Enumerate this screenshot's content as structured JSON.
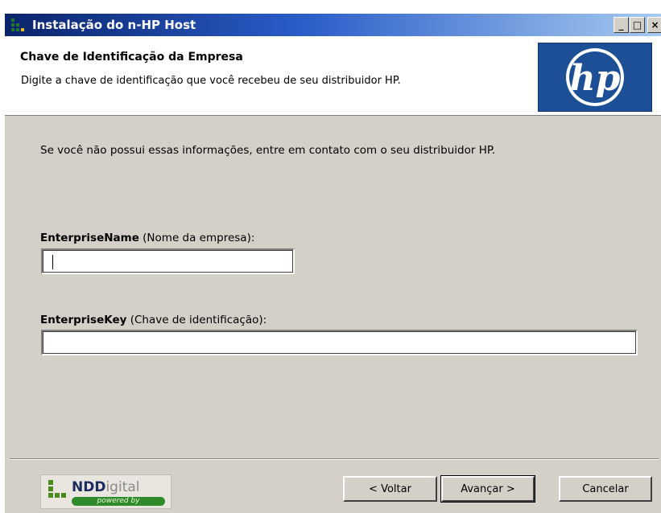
{
  "window": {
    "title": "Instalação do n-HP Host",
    "controls": {
      "minimize_icon": "minimize-icon",
      "maximize_icon": "maximize-icon",
      "close_icon": "close-icon",
      "minimize_glyph": "_",
      "maximize_glyph": "□",
      "close_glyph": "×"
    }
  },
  "header": {
    "title": "Chave de Identificação da Empresa",
    "description": "Digite a chave de identificação que você recebeu de seu distribuidor HP.",
    "logo_text": "hp",
    "logo_color": "#1c4f96"
  },
  "main": {
    "info": "Se você não possui essas informações, entre em contato com o seu distribuidor HP.",
    "enterprise_name": {
      "label_bold": "EnterpriseName",
      "label_note": " (Nome da empresa):",
      "value": ""
    },
    "enterprise_key": {
      "label_bold": "EnterpriseKey",
      "label_note": "  (Chave de identificação):",
      "value": ""
    }
  },
  "footer": {
    "brand_nd": "NDD",
    "brand_digital": "igital",
    "powered": "powered by",
    "back_label": "< Voltar",
    "next_label": "Avançar >",
    "cancel_label": "Cancelar"
  },
  "colors": {
    "dialog_bg": "#d4d0c8",
    "title_start": "#0a246a",
    "title_end": "#a6caf0",
    "ndd_green": "#4a8a1e"
  }
}
